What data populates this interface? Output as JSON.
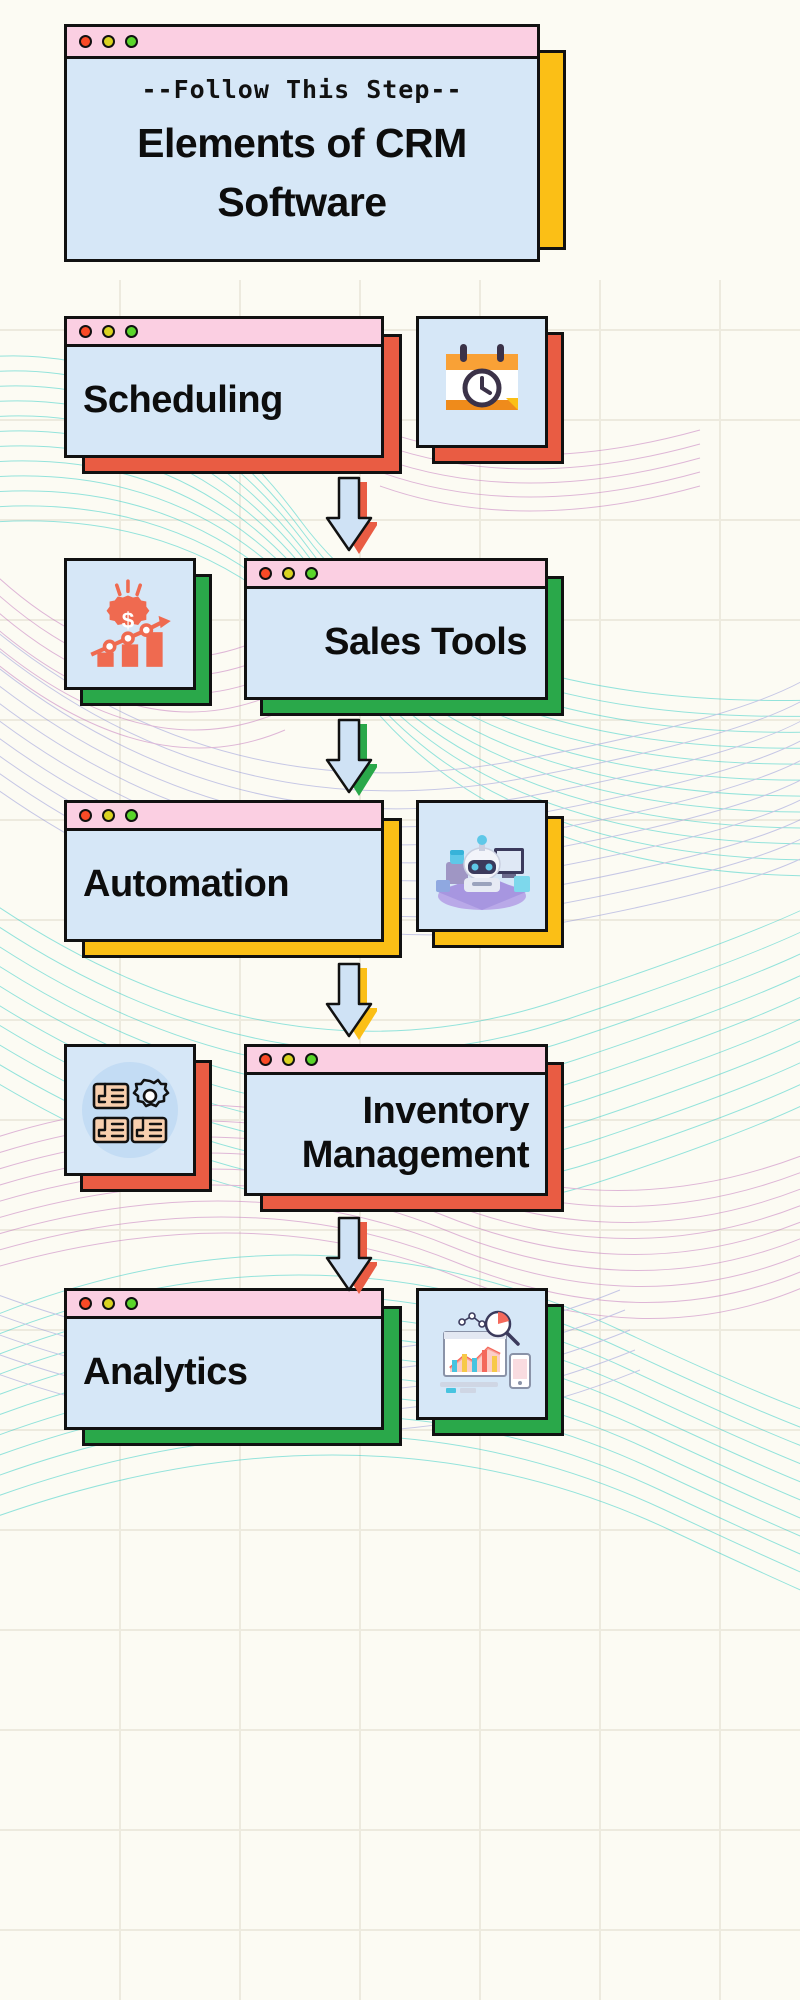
{
  "page": {
    "background_color": "#fcfbf3",
    "card_fill": "#d6e7f7",
    "titlebar_fill": "#fbcfe2",
    "outline_color": "#111111"
  },
  "header": {
    "kicker": "--Follow This Step--",
    "title_line1": "Elements of CRM",
    "title_line2": "Software",
    "shadow_color": "#fbbf16",
    "traffic_lights": [
      "red",
      "yellow",
      "green"
    ]
  },
  "steps": [
    {
      "label": "Scheduling",
      "shadow_color": "#e95c43",
      "icon_name": "calendar-clock-icon",
      "side": "left"
    },
    {
      "label": "Sales Tools",
      "shadow_color": "#2aa84a",
      "icon_name": "sales-growth-chart-icon",
      "side": "right"
    },
    {
      "label": "Automation",
      "shadow_color": "#fbbf16",
      "icon_name": "robot-automation-icon",
      "side": "left"
    },
    {
      "label_line1": "Inventory",
      "label_line2": "Management",
      "label": "Inventory Management",
      "shadow_color": "#e95c43",
      "icon_name": "inventory-boxes-gear-icon",
      "side": "right"
    },
    {
      "label": "Analytics",
      "shadow_color": "#2aa84a",
      "icon_name": "analytics-dashboard-icon",
      "side": "left"
    }
  ],
  "arrows": {
    "fill": "#cfe2f5",
    "shadow": "#e95c43",
    "count": 4,
    "direction": "down"
  }
}
